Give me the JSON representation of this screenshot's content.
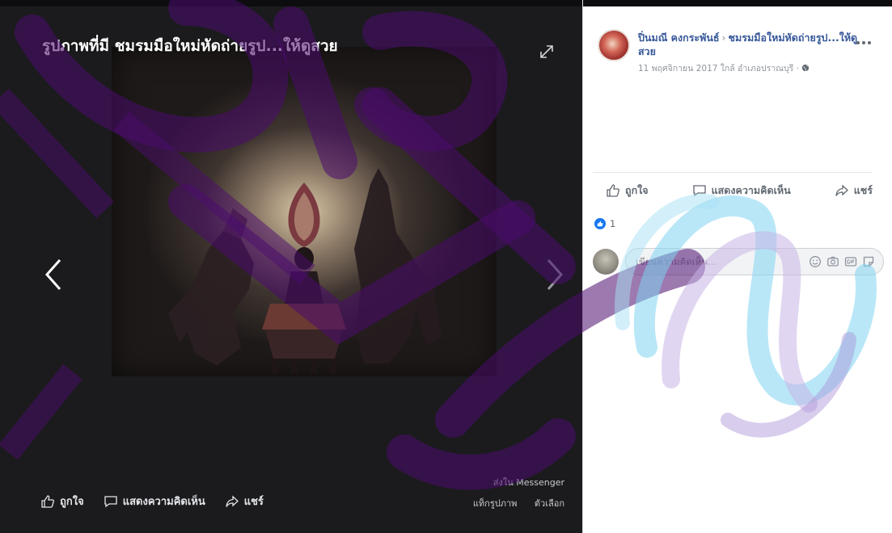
{
  "viewer": {
    "title": "รูปภาพที่มี ชมรมมือใหม่หัดถ่ายรูป...ให้ดูสวย",
    "actions": {
      "like": "ถูกใจ",
      "comment": "แสดงความคิดเห็น",
      "share": "แชร์"
    },
    "links": {
      "send_messenger": "ส่งใน Messenger",
      "tag_photo": "แท็กรูปภาพ",
      "options": "ตัวเลือก"
    }
  },
  "post": {
    "author": "ปิ่นมณี คงกระพันธ์",
    "group": "ชมรมมือใหม่หัดถ่ายรูป...ให้ดูสวย",
    "separator": "›",
    "meta": "11 พฤศจิกายน 2017 ใกล้ อำเภอปราณบุรี · ",
    "actions": {
      "like": "ถูกใจ",
      "comment": "แสดงความคิดเห็น",
      "share": "แชร์"
    },
    "reaction_count": "1",
    "comment_placeholder": "เขียนความคิดเห็น..."
  },
  "icons": {
    "expand": "expand-icon",
    "prev": "chevron-left-icon",
    "next": "chevron-right-icon",
    "like": "thumbs-up-icon",
    "comment": "comment-bubble-icon",
    "share": "share-arrow-icon",
    "more": "more-dots-icon",
    "globe": "globe-icon",
    "emoji": "emoji-icon",
    "camera": "camera-icon",
    "gif": "gif-icon",
    "sticker": "sticker-icon"
  },
  "colors": {
    "viewer_bg": "#1b1b1d",
    "link_blue": "#365899",
    "like_blue": "#1877f2",
    "muted_text": "#606770"
  }
}
